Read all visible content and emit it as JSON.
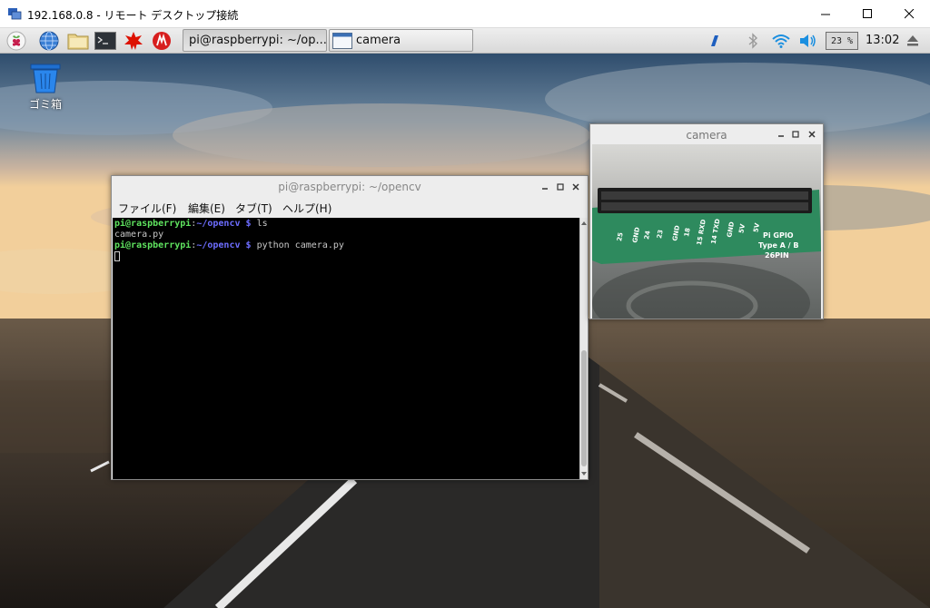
{
  "rdp": {
    "title": "192.168.0.8 - リモート デスクトップ接続"
  },
  "panel": {
    "launchers": [
      "raspberry-menu",
      "web-browser",
      "file-manager",
      "terminal",
      "wolfram",
      "mathematica"
    ],
    "tasks": [
      {
        "label": "pi@raspberrypi: ~/op..."
      },
      {
        "label": "camera"
      }
    ],
    "cpu": "23 %",
    "clock": "13:02"
  },
  "desktop": {
    "trash_label": "ゴミ箱"
  },
  "terminal": {
    "title": "pi@raspberrypi: ~/opencv",
    "menu": [
      "ファイル(F)",
      "編集(E)",
      "タブ(T)",
      "ヘルプ(H)"
    ],
    "lines": [
      {
        "user": "pi@raspberrypi",
        "sep": ":",
        "path": "~/opencv $",
        "cmd": " ls"
      },
      {
        "output": "camera.py"
      },
      {
        "user": "pi@raspberrypi",
        "sep": ":",
        "path": "~/opencv $",
        "cmd": " python camera.py"
      }
    ]
  },
  "camera": {
    "title": "camera",
    "pcb": {
      "header_labels": [
        "25",
        "GND",
        "24",
        "23",
        "GND",
        "18",
        "15 RXD",
        "14 TXD",
        "GND",
        "5V",
        "5V"
      ],
      "brand": "Pi GPIO",
      "sub": "Type A / B",
      "pins": "26PIN"
    }
  },
  "colors": {
    "prompt_user": "#5fe35f",
    "prompt_path": "#6d6dff",
    "terminal_bg": "#000000",
    "pcb_green": "#2e8a5e"
  }
}
